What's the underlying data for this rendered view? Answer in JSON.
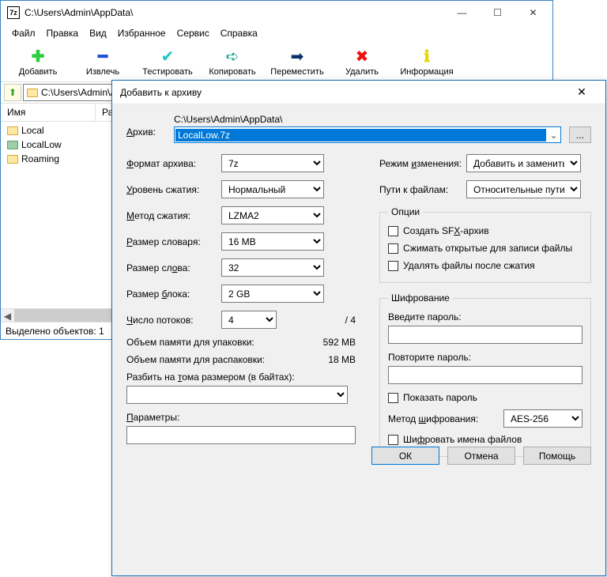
{
  "main_window": {
    "app_icon_text": "7z",
    "title": "C:\\Users\\Admin\\AppData\\",
    "min": "—",
    "max": "☐",
    "close": "✕",
    "menu": {
      "file": "Файл",
      "edit": "Правка",
      "view": "Вид",
      "favorites": "Избранное",
      "tools": "Сервис",
      "help": "Справка"
    },
    "toolbar": {
      "add": "Добавить",
      "extract": "Извлечь",
      "test": "Тестировать",
      "copy": "Копировать",
      "move": "Переместить",
      "delete": "Удалить",
      "info": "Информация"
    },
    "address_path": "C:\\Users\\Admin\\AppData\\",
    "columns": {
      "name": "Имя",
      "size": "Разме"
    },
    "files": [
      "Local",
      "LocalLow",
      "Roaming"
    ],
    "status": "Выделено объектов: 1"
  },
  "dialog": {
    "title": "Добавить к архиву",
    "close_x": "✕",
    "archive_label": "Архив:",
    "archive_path": "C:\\Users\\Admin\\AppData\\",
    "archive_name": "LocalLow.7z",
    "browse": "...",
    "format_label": "Формат архива:",
    "format_value": "7z",
    "level_label": "Уровень сжатия:",
    "level_value": "Нормальный",
    "method_label": "Метод сжатия:",
    "method_value": "LZMA2",
    "dict_label": "Размер словаря:",
    "dict_value": "16 MB",
    "word_label": "Размер слова:",
    "word_value": "32",
    "block_label": "Размер блока:",
    "block_value": "2 GB",
    "threads_label": "Число потоков:",
    "threads_value": "4",
    "threads_max": "/ 4",
    "mem_pack_label": "Объем памяти для упаковки:",
    "mem_pack_value": "592 MB",
    "mem_unpack_label": "Объем памяти для распаковки:",
    "mem_unpack_value": "18 MB",
    "split_label": "Разбить на тома размером (в байтах):",
    "params_label": "Параметры:",
    "update_label": "Режим изменения:",
    "update_value": "Добавить и заменить",
    "paths_label": "Пути к файлам:",
    "paths_value": "Относительные пути",
    "options_legend": "Опции",
    "opt_sfx": "Создать SFX-архив",
    "opt_open": "Сжимать открытые для записи файлы",
    "opt_delete": "Удалять файлы после сжатия",
    "enc_legend": "Шифрование",
    "enc_pass1": "Введите пароль:",
    "enc_pass2": "Повторите пароль:",
    "enc_show": "Показать пароль",
    "enc_method_label": "Метод шифрования:",
    "enc_method_value": "AES-256",
    "enc_names": "Шифровать имена файлов",
    "btn_ok": "ОК",
    "btn_cancel": "Отмена",
    "btn_help": "Помощь"
  }
}
